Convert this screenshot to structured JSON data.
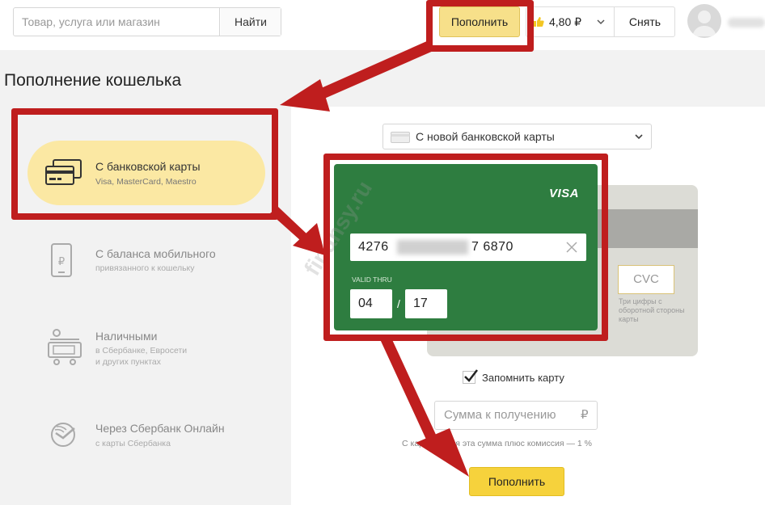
{
  "header": {
    "search_placeholder": "Товар, услуга или магазин",
    "search_button": "Найти",
    "topup_button": "Пополнить",
    "balance": "4,80 ₽",
    "withdraw_button": "Снять"
  },
  "page_title": "Пополнение кошелька",
  "methods": [
    {
      "title": "С банковской карты",
      "subtitle": "Visa, MasterCard, Maestro",
      "active": true
    },
    {
      "title": "С баланса мобильного",
      "subtitle": "привязанного к кошельку",
      "active": false
    },
    {
      "title": "Наличными",
      "subtitle": "в Сбербанке, Евросети",
      "subtitle2": "и других пунктах",
      "active": false
    },
    {
      "title": "Через Сбербанк Онлайн",
      "subtitle": "с карты Сбербанка",
      "active": false
    }
  ],
  "card_select": {
    "value": "С новой банковской карты"
  },
  "card": {
    "brand": "VISA",
    "number_start": "4276",
    "number_end": "7 6870",
    "valid_thru_label": "VALID THRU",
    "month": "04",
    "separator": "/",
    "year": "17",
    "cvc_placeholder": "CVC",
    "cvc_hint": "Три цифры с оборотной стороны карты"
  },
  "remember_card": {
    "label": "Запомнить карту",
    "checked": true
  },
  "amount": {
    "placeholder": "Сумма к получению",
    "currency": "₽"
  },
  "commission_note": "С карты ...ется эта сумма плюс комиссия — 1 %",
  "submit_button": "Пополнить",
  "watermark": "finansy.ru",
  "colors": {
    "accent_yellow": "#f6d23c",
    "card_green": "#2e7d40",
    "annotation_red": "#bf1e1e"
  }
}
